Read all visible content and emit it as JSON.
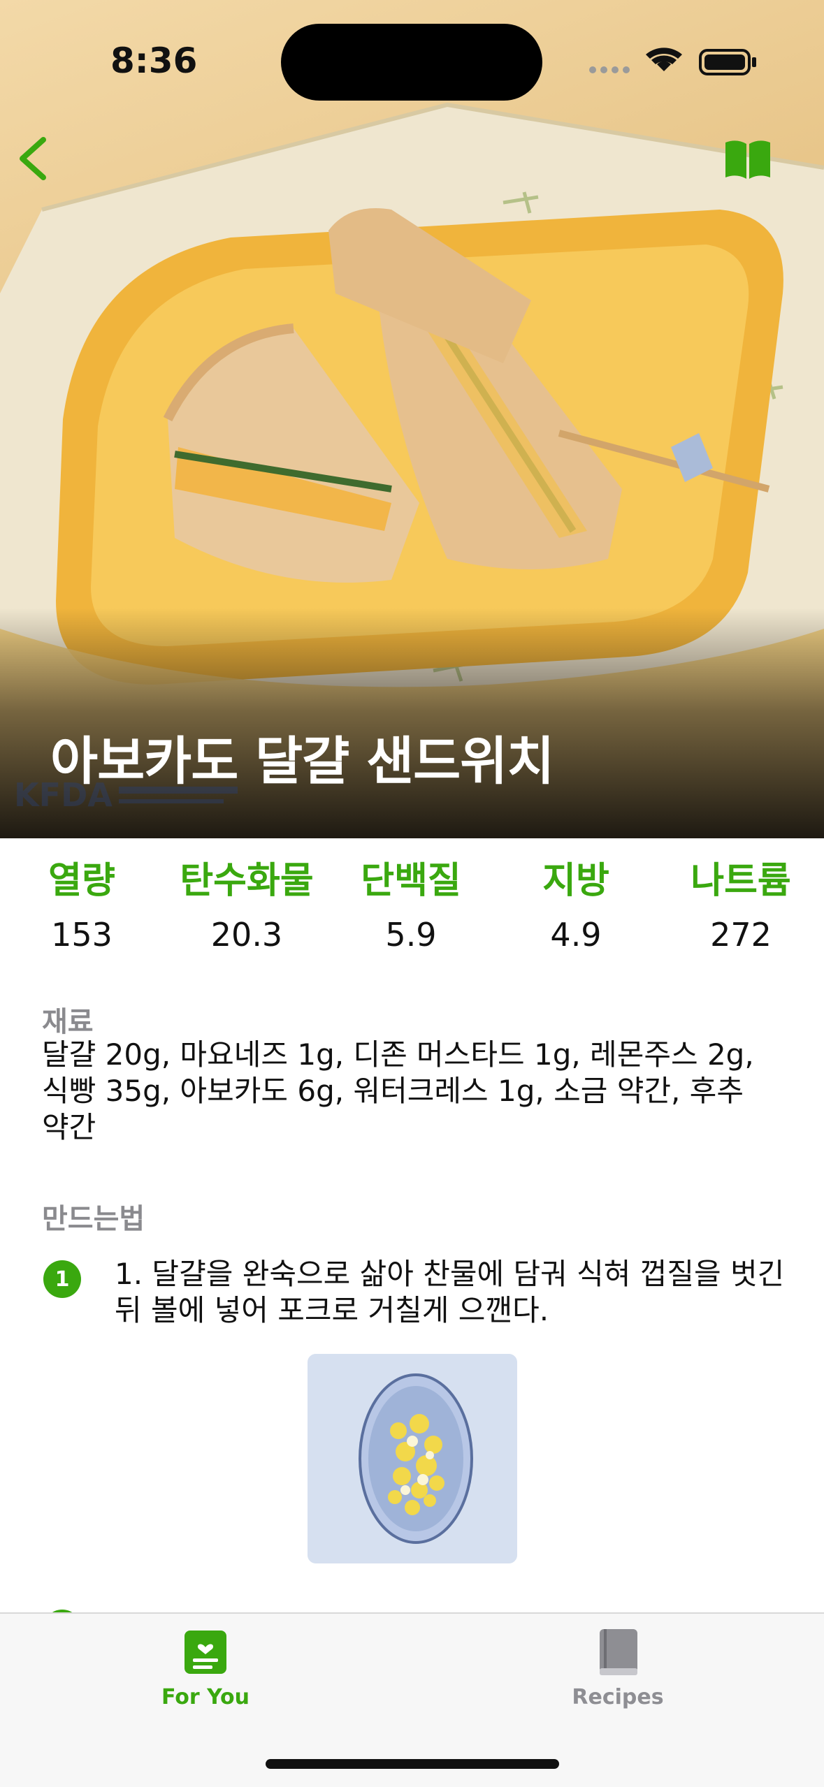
{
  "status_bar": {
    "time": "8:36"
  },
  "nav": {
    "back_icon": "chevron-left-icon",
    "bookmark_icon": "open-book-icon",
    "accent": "#3aa80f"
  },
  "recipe": {
    "title": "아보카도 달걀 샌드위치",
    "nutrition": [
      {
        "label": "열량",
        "value": "153"
      },
      {
        "label": "탄수화물",
        "value": "20.3"
      },
      {
        "label": "단백질",
        "value": "5.9"
      },
      {
        "label": "지방",
        "value": "4.9"
      },
      {
        "label": "나트륨",
        "value": "272"
      }
    ],
    "ingredients_title": "재료",
    "ingredients": "달걀 20g, 마요네즈 1g, 디존 머스타드 1g, 레몬주스 2g, 식빵 35g, 아보카도 6g, 워터크레스 1g, 소금 약간, 후추 약간",
    "method_title": "만드는법",
    "steps": [
      {
        "number": "1",
        "text": "1. 달걀을 완숙으로 삶아 찬물에 담궈 식혀 껍질을 벗긴 뒤 볼에 넣어 포크로 거칠게 으깬다."
      }
    ]
  },
  "tabbar": {
    "tabs": [
      {
        "label": "For You",
        "icon": "heart-list-icon",
        "active": true
      },
      {
        "label": "Recipes",
        "icon": "book-icon",
        "active": false
      }
    ]
  }
}
